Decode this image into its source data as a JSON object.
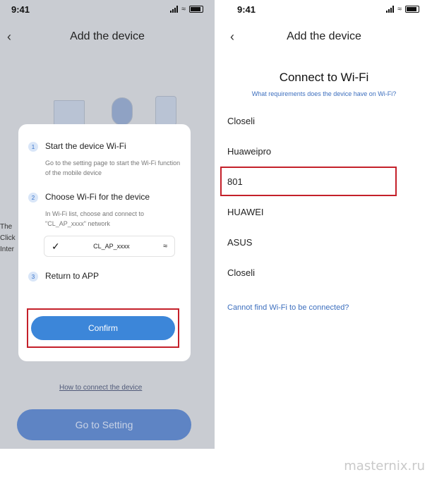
{
  "left": {
    "status_time": "9:41",
    "nav_title": "Add the device",
    "bg_texts": [
      "The",
      "Click",
      "Inter"
    ],
    "steps": [
      {
        "num": "1",
        "title": "Start the device Wi-Fi",
        "desc": "Go to the setting page to start the Wi-Fi function of the mobile device"
      },
      {
        "num": "2",
        "title": "Choose  Wi-Fi for the device",
        "desc": "In Wi-Fi list, choose and connect to \"CL_AP_xxxx\" network"
      },
      {
        "num": "3",
        "title": "Return to APP",
        "desc": ""
      }
    ],
    "wifi_ssid": "CL_AP_xxxx",
    "confirm_label": "Confirm",
    "howto_link": "How to connect the device",
    "goto_label": "Go to Setting",
    "icons": {
      "back": "chevron-left-icon",
      "check": "check-icon",
      "wifi": "wifi-icon"
    }
  },
  "right": {
    "status_time": "9:41",
    "nav_title": "Add the device",
    "title": "Connect to Wi-Fi",
    "subtitle": "What requirements does the device have on Wi-Fi?",
    "networks": [
      "Closeli",
      "Huaweipro",
      "801",
      "HUAWEI",
      "ASUS",
      "Closeli"
    ],
    "cannot_find": "Cannot find Wi-Fi to be connected?"
  },
  "colors": {
    "accent_blue": "#3c86d9",
    "highlight_red": "#c4202a",
    "link_blue": "#3d6fbe"
  },
  "watermark": "masternix.ru"
}
